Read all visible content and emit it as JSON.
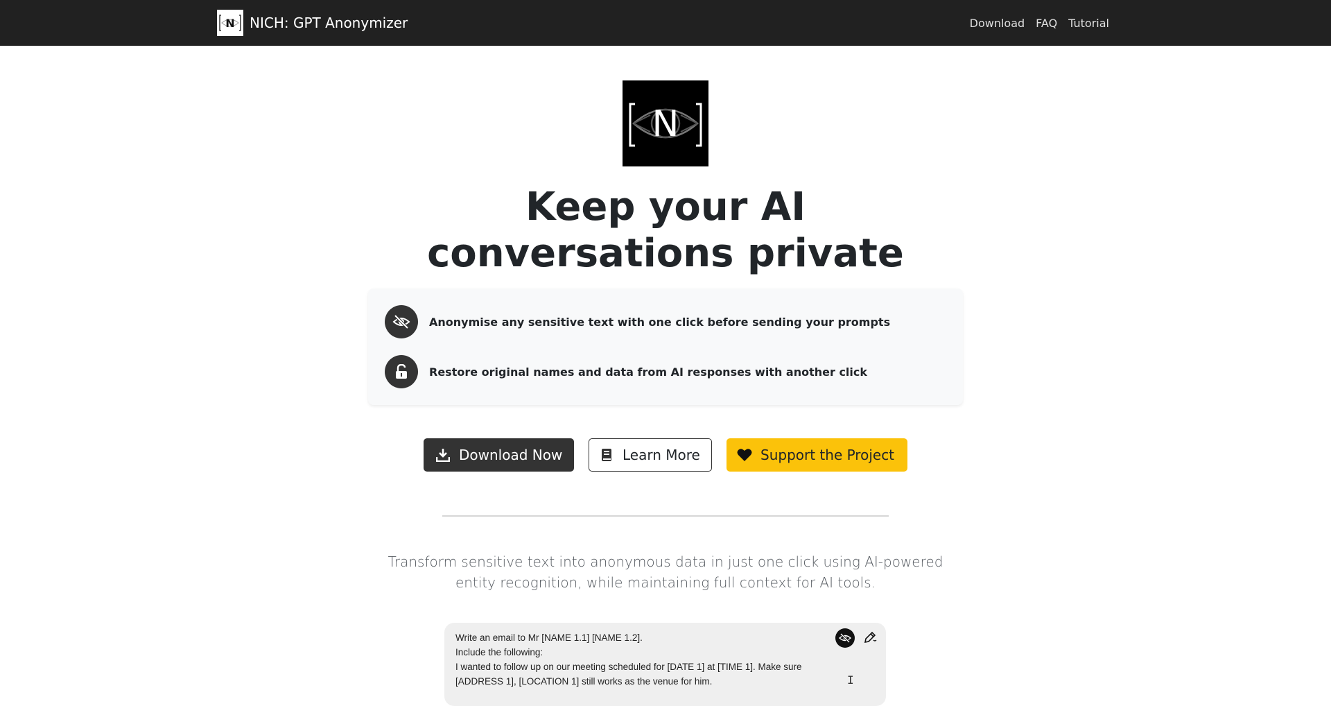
{
  "navbar": {
    "brand_title": "NICH: GPT Anonymizer",
    "brand_logo_letter": "N",
    "links": [
      "Download",
      "FAQ",
      "Tutorial"
    ]
  },
  "hero": {
    "logo_letter": "N",
    "title_line1": "Keep your AI",
    "title_line2": "conversations private"
  },
  "features": [
    {
      "icon": "eye-slash-icon",
      "text": "Anonymise any sensitive text with one click before sending your prompts"
    },
    {
      "icon": "unlock-icon",
      "text": "Restore original names and data from AI responses with another click"
    }
  ],
  "buttons": {
    "download": {
      "label": "Download Now",
      "icon": "download-icon"
    },
    "learn": {
      "label": "Learn More",
      "icon": "book-icon"
    },
    "support": {
      "label": "Support the Project",
      "icon": "heart-icon"
    }
  },
  "lead": "Transform sensitive text into anonymous data in just one click using AI-powered entity recognition, while maintaining full context for AI tools.",
  "demo": {
    "lines": [
      "Write an email to Mr [NAME 1.1] [NAME 1.2].",
      "Include the following:",
      "I wanted to follow up on our meeting scheduled for [DATE 1] at [TIME 1]. Make sure [ADDRESS 1], [LOCATION 1] still works as the venue for him."
    ]
  },
  "colors": {
    "navbar_bg": "#212121",
    "primary_dark": "#333333",
    "support_yellow": "#fbc20a",
    "feature_card_bg": "#f8f9fa"
  }
}
